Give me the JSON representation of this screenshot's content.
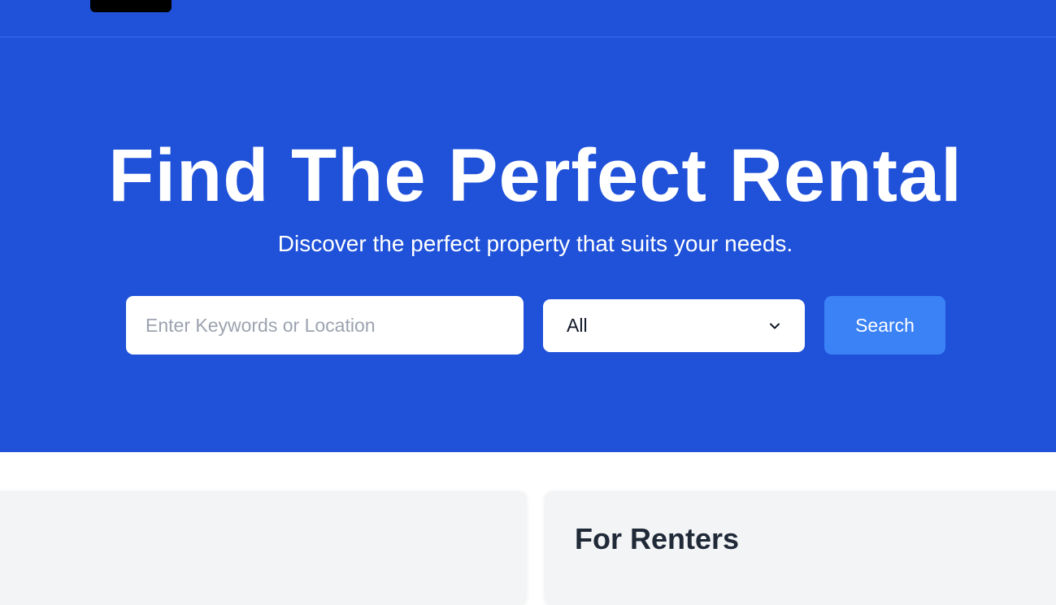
{
  "hero": {
    "title": "Find The Perfect Rental",
    "subtitle": "Discover the perfect property that suits your needs."
  },
  "search": {
    "placeholder": "Enter Keywords or Location",
    "value": "",
    "type_selected": "All",
    "button_label": "Search"
  },
  "cards": [
    {
      "title": "",
      "text": ""
    },
    {
      "title": "For Renters",
      "text": ""
    }
  ],
  "colors": {
    "brand_blue": "#1f51d9",
    "button_blue": "#3b82f6",
    "card_bg": "#f3f4f6"
  }
}
